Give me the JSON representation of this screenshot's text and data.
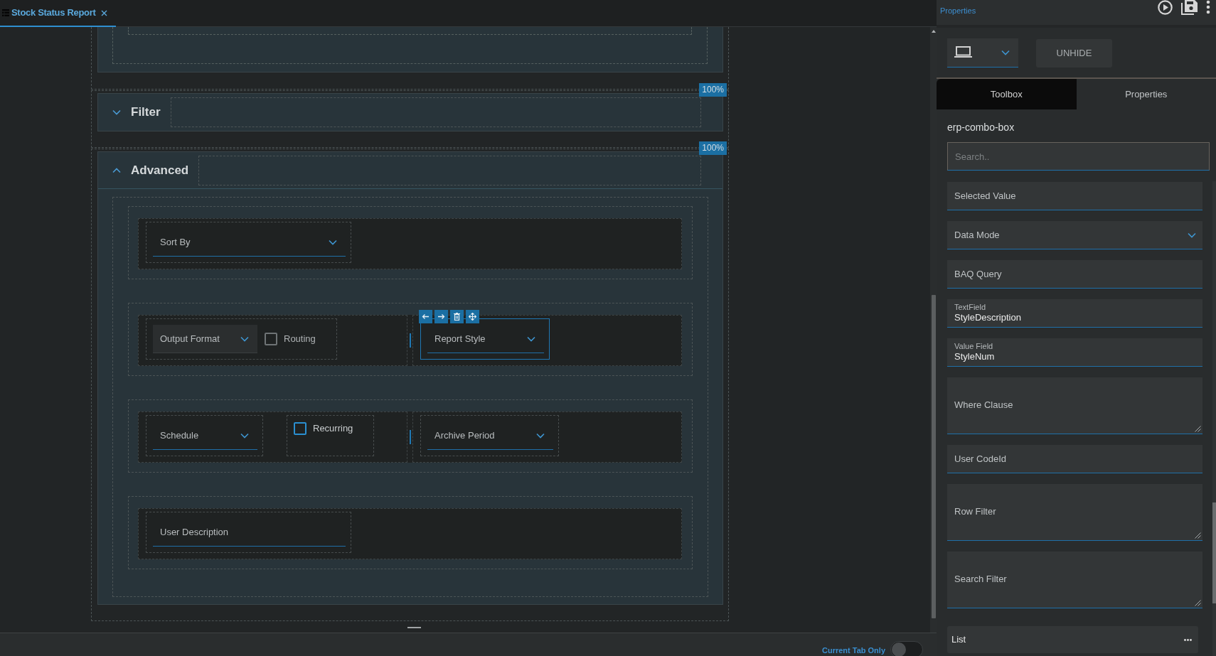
{
  "tab": {
    "title": "Stock Status Report",
    "selected": true
  },
  "canvas": {
    "sections": [
      {
        "title": "Filter",
        "expanded": false,
        "badge": "100%"
      },
      {
        "title": "Advanced",
        "expanded": true,
        "badge": "100%",
        "rows": [
          {
            "columns": [
              {
                "cells": [
                  {
                    "controls": [
                      {
                        "kind": "dropdown",
                        "label": "Sort By",
                        "selected": false,
                        "hovered": false,
                        "disabled": false
                      }
                    ]
                  }
                ]
              }
            ]
          },
          {
            "columns": [
              {
                "cells": [
                  {
                    "controls": [
                      {
                        "kind": "dropdown",
                        "label": "Output Format",
                        "selected": false,
                        "hovered": true,
                        "disabled": false
                      },
                      {
                        "kind": "checkbox",
                        "label": "Routing",
                        "checked": false,
                        "selected": false,
                        "hovered": false,
                        "disabled": true
                      }
                    ]
                  }
                ]
              },
              {
                "cells": [
                  {
                    "controls": [
                      {
                        "kind": "dropdown",
                        "label": "Report Style",
                        "selected": true,
                        "hovered": false,
                        "disabled": false
                      }
                    ]
                  }
                ]
              }
            ]
          },
          {
            "columns": [
              {
                "cells": [
                  {
                    "controls": [
                      {
                        "kind": "dropdown",
                        "label": "Schedule",
                        "selected": false,
                        "hovered": false,
                        "disabled": false
                      }
                    ]
                  },
                  {
                    "controls": [
                      {
                        "kind": "checkbox",
                        "label": "Recurring",
                        "checked": false,
                        "selected": false,
                        "hovered": false,
                        "disabled": false
                      }
                    ]
                  }
                ]
              },
              {
                "cells": [
                  {
                    "controls": [
                      {
                        "kind": "dropdown",
                        "label": "Archive Period",
                        "selected": false,
                        "hovered": false,
                        "disabled": false
                      }
                    ]
                  }
                ]
              }
            ]
          },
          {
            "columns": [
              {
                "cells": [
                  {
                    "controls": [
                      {
                        "kind": "text",
                        "label": "User Description",
                        "selected": false,
                        "hovered": false,
                        "disabled": false
                      }
                    ]
                  }
                ]
              }
            ]
          }
        ]
      }
    ]
  },
  "status_bar": {
    "toggle": {
      "label": "Current Tab Only",
      "on": false
    }
  },
  "properties_panel": {
    "link": "Properties",
    "unhide_button": "UNHIDE",
    "tabs": [
      {
        "label": "Toolbox",
        "selected": true
      },
      {
        "label": "Properties",
        "selected": false
      }
    ],
    "component": "erp-combo-box",
    "search": {
      "placeholder": "Search.."
    },
    "fields": [
      {
        "kind": "text",
        "label": "Selected Value"
      },
      {
        "kind": "select",
        "label": "Data Mode"
      },
      {
        "kind": "text",
        "label": "BAQ Query"
      },
      {
        "kind": "text",
        "label": "TextField",
        "value": "StyleDescription"
      },
      {
        "kind": "text",
        "label": "Value Field",
        "value": "StyleNum"
      },
      {
        "kind": "textarea",
        "label": "Where Clause"
      },
      {
        "kind": "text",
        "label": "User CodeId"
      },
      {
        "kind": "textarea",
        "label": "Row Filter"
      },
      {
        "kind": "textarea",
        "label": "Search Filter"
      },
      {
        "kind": "list",
        "label": "List"
      }
    ]
  }
}
